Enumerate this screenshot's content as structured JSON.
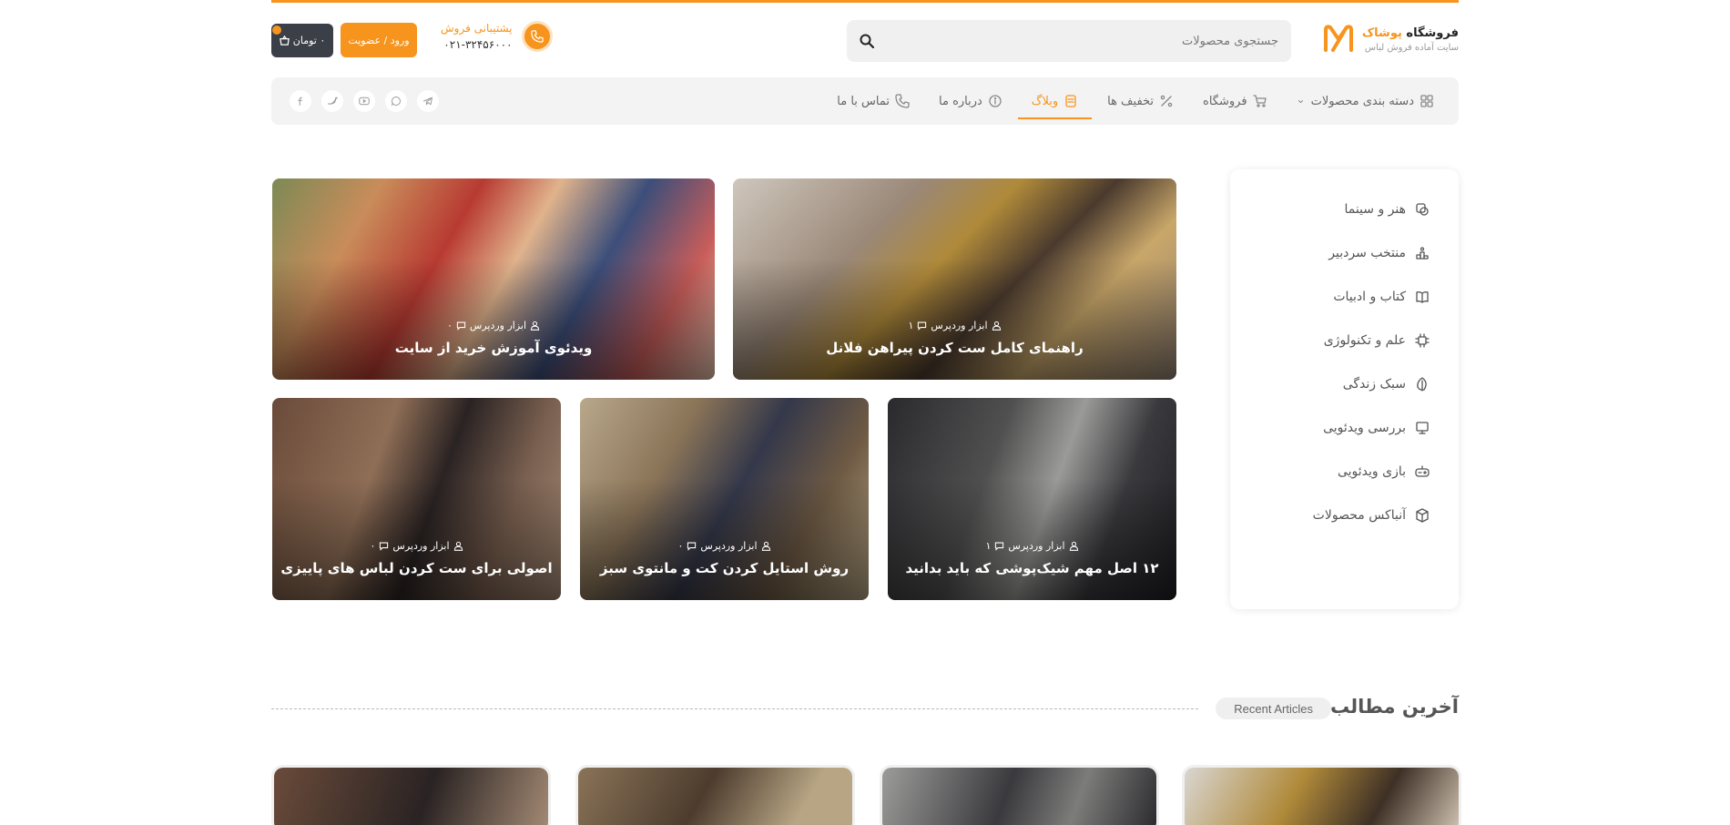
{
  "header": {
    "logo_title_part1": "فروشگاه",
    "logo_title_part2": "پوشاک",
    "logo_subtitle": "سایت آماده فروش لباس",
    "search_placeholder": "جستجوی محصولات",
    "support_label": "پشتیبانی فروش",
    "support_phone": "۰۲۱-۳۲۴۵۶۰۰۰",
    "login_label": "ورود / عضویت",
    "cart_label": "۰ تومان"
  },
  "nav": {
    "items": [
      {
        "label": "دسته بندی محصولات",
        "icon": "grid-icon"
      },
      {
        "label": "فروشگاه",
        "icon": "cart-icon"
      },
      {
        "label": "تخفیف ها",
        "icon": "percent-icon"
      },
      {
        "label": "وبلاگ",
        "icon": "blog-icon"
      },
      {
        "label": "درباره ما",
        "icon": "info-icon"
      },
      {
        "label": "تماس با ما",
        "icon": "phone-icon"
      }
    ],
    "active_index": 3,
    "socials": [
      "facebook-icon",
      "twitter-icon",
      "youtube-icon",
      "whatsapp-icon",
      "telegram-icon"
    ]
  },
  "categories": [
    {
      "label": "هنر و سینما",
      "icon": "art-icon"
    },
    {
      "label": "منتخب سردبیر",
      "icon": "podium-icon"
    },
    {
      "label": "کتاب و ادبیات",
      "icon": "book-icon"
    },
    {
      "label": "علم و تکنولوژی",
      "icon": "chip-icon"
    },
    {
      "label": "سبک زندگی",
      "icon": "leaf-icon"
    },
    {
      "label": "بررسی ویدئویی",
      "icon": "monitor-icon"
    },
    {
      "label": "بازی ویدئویی",
      "icon": "gamepad-icon"
    },
    {
      "label": "آنباکس محصولات",
      "icon": "box-icon"
    }
  ],
  "featured": [
    {
      "title": "راهنمای کامل ست کردن پیراهن فلانل",
      "author": "ابزار وردپرس",
      "comments": "۱"
    },
    {
      "title": "ویدئوی آموزش خرید از سایت",
      "author": "ابزار وردپرس",
      "comments": "۰"
    },
    {
      "title": "۱۲ اصل مهم شیک‌پوشی که باید بدانید",
      "author": "ابزار وردپرس",
      "comments": "۱"
    },
    {
      "title": "روش استایل کردن کت و مانتوی سبز",
      "author": "ابزار وردپرس",
      "comments": "۰"
    },
    {
      "title": "اصولی برای ست کردن لباس های پاییزی",
      "author": "ابزار وردپرس",
      "comments": "۰"
    }
  ],
  "recent": {
    "title": "آخرین مطالب",
    "subtitle": "Recent Articles"
  },
  "colors": {
    "accent": "#f7941d",
    "dark_button": "#3b3f48"
  }
}
